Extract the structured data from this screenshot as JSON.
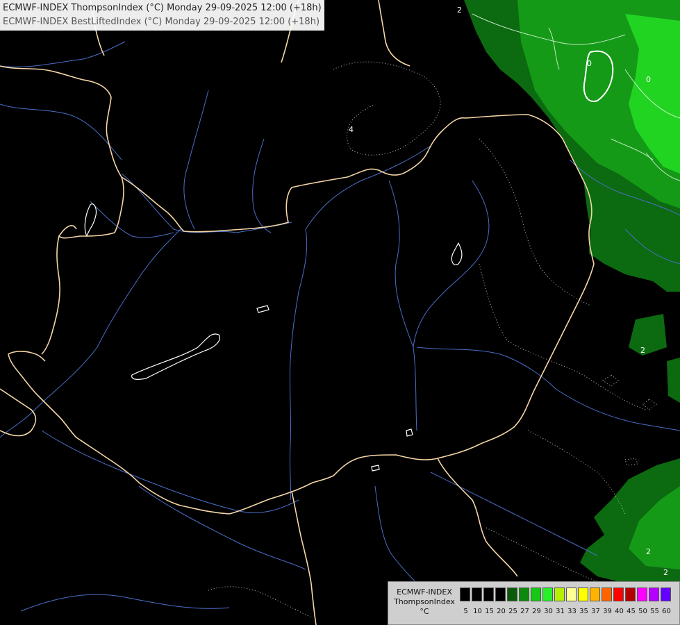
{
  "title": {
    "line1": "ECMWF-INDEX ThompsonIndex (°C) Monday 29-09-2025 12:00 (+18h)",
    "line2": "ECMWF-INDEX BestLiftedIndex (°C) Monday 29-09-2025 12:00 (+18h)"
  },
  "legend": {
    "label_model": "ECMWF-INDEX",
    "label_param": "ThompsonIndex",
    "label_unit": "°C",
    "ticks": [
      "5",
      "10",
      "15",
      "20",
      "25",
      "27",
      "29",
      "30",
      "31",
      "33",
      "35",
      "37",
      "39",
      "40",
      "45",
      "50",
      "55",
      "60"
    ],
    "colors": [
      "#000000",
      "#000000",
      "#000000",
      "#000000",
      "#0a5a0a",
      "#0c8a0c",
      "#14c814",
      "#28f028",
      "#b4f000",
      "#ffff96",
      "#ffff00",
      "#ffb400",
      "#ff6400",
      "#ff0000",
      "#b40000",
      "#ff00ff",
      "#b400ff",
      "#6400ff"
    ]
  },
  "map_colors": {
    "background": "#000000",
    "border": "#f4d6a6",
    "river": "#4a6fc8",
    "contour": "#ffffff",
    "green_dark": "#0c6a10",
    "green_mid": "#159a18",
    "green_bright": "#22d422"
  },
  "contour_labels": [
    "4",
    "2",
    "0",
    "2",
    "0",
    "2",
    "2"
  ]
}
